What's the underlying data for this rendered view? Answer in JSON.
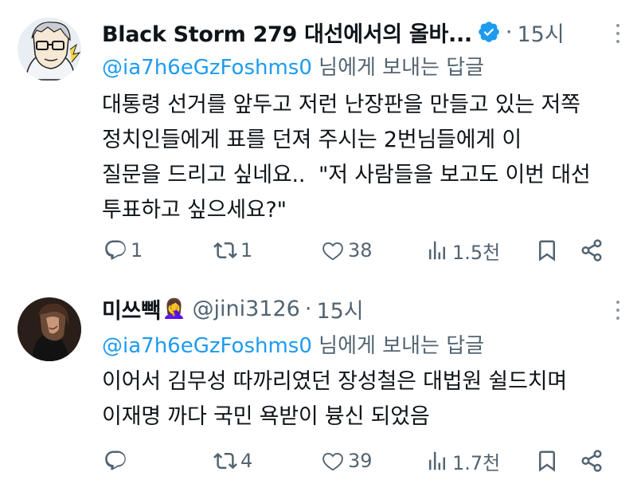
{
  "tweets": [
    {
      "name": "Black Storm 279 대선에서의 올바...",
      "verified": true,
      "time": "15시",
      "reply_prefix": "@ia7h6eGzFoshms0",
      "reply_suffix": " 님에게 보내는 답글",
      "text": "대통령 선거를 앞두고 저런 난장판을 만들고 있는 저쪽\n정치인들에게 표를 던져 주시는 2번님들에게 이\n질문을 드리고 싶네요..  \"저 사람들을 보고도 이번 대선\n투표하고 싶으세요?\"",
      "replies": "1",
      "retweets": "1",
      "likes": "38",
      "views": "1.5천"
    },
    {
      "name": "미쓰빽",
      "emoji": "🤦‍♀️",
      "handle": "@jini3126",
      "time": "15시",
      "reply_prefix": "@ia7h6eGzFoshms0",
      "reply_suffix": " 님에게 보내는 답글",
      "text": "이어서 김무성 따까리였던 장성철은 대법원 쉴드치며\n이재명 까다 국민 욕받이 븅신 되었음",
      "replies": "",
      "retweets": "4",
      "likes": "39",
      "views": "1.7천"
    }
  ],
  "colors": {
    "text": "#0f1419",
    "secondary": "#536471",
    "link": "#1d9bf0",
    "verified": "#1d9bf0"
  }
}
